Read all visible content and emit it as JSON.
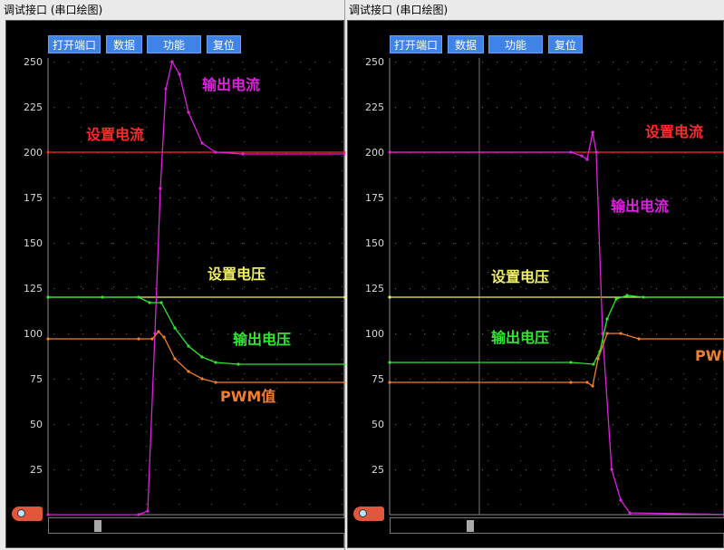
{
  "window_title": "调试接口 (串口绘图)",
  "toolbar": {
    "open_port": "打开端口",
    "data": "数据",
    "function": "功能",
    "reset": "复位"
  },
  "colors": {
    "set_current": "#ff2a2a",
    "out_current": "#e01fe0",
    "set_voltage": "#f0f060",
    "out_voltage": "#2ee82e",
    "pwm": "#f08030"
  },
  "chart_data": [
    {
      "type": "line",
      "ylim": [
        0,
        250
      ],
      "yticks": [
        25,
        50,
        75,
        100,
        125,
        150,
        175,
        200,
        225,
        250
      ],
      "labels": {
        "set_current": "设置电流",
        "out_current": "输出电流",
        "set_voltage": "设置电压",
        "out_voltage": "输出电压",
        "pwm": "PWM值"
      },
      "series": [
        {
          "key": "set_current",
          "name": "设置电流",
          "points": [
            [
              0,
              200
            ],
            [
              328,
              200
            ]
          ]
        },
        {
          "key": "set_voltage",
          "name": "设置电压",
          "points": [
            [
              0,
              120
            ],
            [
              328,
              120
            ]
          ]
        },
        {
          "key": "out_current",
          "name": "输出电流",
          "points": [
            [
              0,
              0
            ],
            [
              100,
              0
            ],
            [
              110,
              2
            ],
            [
              118,
              100
            ],
            [
              124,
              180
            ],
            [
              130,
              235
            ],
            [
              137,
              250
            ],
            [
              145,
              243
            ],
            [
              155,
              222
            ],
            [
              170,
              205
            ],
            [
              185,
              200
            ],
            [
              215,
              199
            ],
            [
              328,
              199
            ]
          ]
        },
        {
          "key": "out_voltage",
          "name": "输出电压",
          "points": [
            [
              0,
              120
            ],
            [
              60,
              120
            ],
            [
              100,
              120
            ],
            [
              112,
              117
            ],
            [
              125,
              117
            ],
            [
              140,
              103
            ],
            [
              155,
              93
            ],
            [
              170,
              87
            ],
            [
              185,
              84
            ],
            [
              210,
              83
            ],
            [
              328,
              83
            ]
          ]
        },
        {
          "key": "pwm",
          "name": "PWM值",
          "points": [
            [
              0,
              97
            ],
            [
              100,
              97
            ],
            [
              115,
              97
            ],
            [
              122,
              101
            ],
            [
              128,
              98
            ],
            [
              140,
              86
            ],
            [
              155,
              79
            ],
            [
              170,
              75
            ],
            [
              185,
              73
            ],
            [
              328,
              73
            ]
          ]
        }
      ]
    },
    {
      "type": "line",
      "ylim": [
        0,
        250
      ],
      "yticks": [
        25,
        50,
        75,
        100,
        125,
        150,
        175,
        200,
        225,
        250
      ],
      "labels": {
        "set_current": "设置电流",
        "out_current": "输出电流",
        "set_voltage": "设置电压",
        "out_voltage": "输出电压",
        "pwm": "PWM"
      },
      "series": [
        {
          "key": "set_current",
          "name": "设置电流",
          "points": [
            [
              0,
              200
            ],
            [
              380,
              200
            ]
          ]
        },
        {
          "key": "set_voltage",
          "name": "设置电压",
          "points": [
            [
              0,
              120
            ],
            [
              380,
              120
            ]
          ]
        },
        {
          "key": "out_current",
          "name": "输出电流",
          "points": [
            [
              0,
              200
            ],
            [
              200,
              200
            ],
            [
              212,
              198
            ],
            [
              218,
              196
            ],
            [
              224,
              211
            ],
            [
              228,
              200
            ],
            [
              235,
              100
            ],
            [
              245,
              25
            ],
            [
              255,
              8
            ],
            [
              265,
              1
            ],
            [
              380,
              0
            ]
          ]
        },
        {
          "key": "out_voltage",
          "name": "输出电压",
          "points": [
            [
              0,
              84
            ],
            [
              200,
              84
            ],
            [
              225,
              83
            ],
            [
              232,
              90
            ],
            [
              240,
              108
            ],
            [
              250,
              119
            ],
            [
              262,
              121
            ],
            [
              280,
              120
            ],
            [
              380,
              120
            ]
          ]
        },
        {
          "key": "pwm",
          "name": "PWM",
          "points": [
            [
              0,
              73
            ],
            [
              200,
              73
            ],
            [
              218,
              73
            ],
            [
              224,
              71
            ],
            [
              230,
              86
            ],
            [
              240,
              100
            ],
            [
              255,
              100
            ],
            [
              275,
              97
            ],
            [
              380,
              97
            ]
          ]
        }
      ]
    }
  ]
}
